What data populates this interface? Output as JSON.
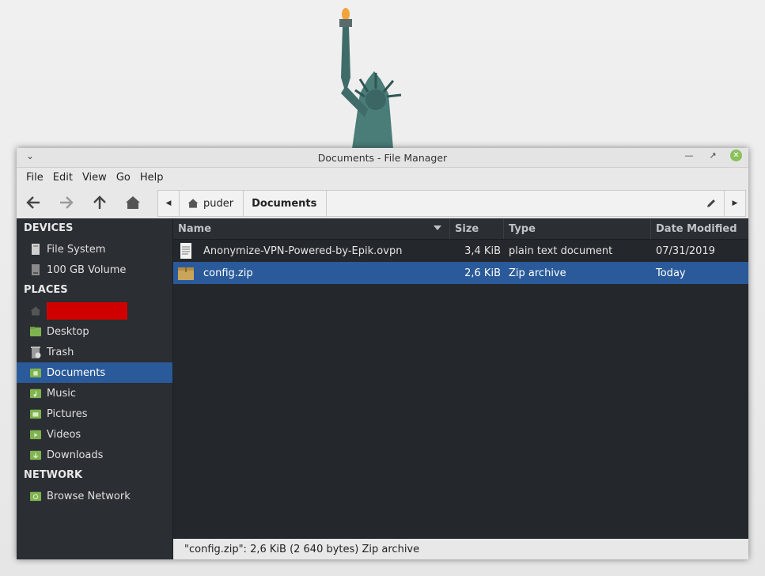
{
  "window": {
    "title": "Documents - File Manager"
  },
  "menu": [
    "File",
    "Edit",
    "View",
    "Go",
    "Help"
  ],
  "pathbar": {
    "crumbs": [
      "puder",
      "Documents"
    ]
  },
  "sidebar": {
    "devices_label": "DEVICES",
    "devices": [
      "File System",
      "100 GB Volume"
    ],
    "places_label": "PLACES",
    "places": [
      "Desktop",
      "Trash",
      "Documents",
      "Music",
      "Pictures",
      "Videos",
      "Downloads"
    ],
    "network_label": "NETWORK",
    "network": [
      "Browse Network"
    ]
  },
  "columns": {
    "name": "Name",
    "size": "Size",
    "type": "Type",
    "date": "Date Modified"
  },
  "files": [
    {
      "name": "Anonymize-VPN-Powered-by-Epik.ovpn",
      "size": "3,4 KiB",
      "type": "plain text document",
      "date": "07/31/2019"
    },
    {
      "name": "config.zip",
      "size": "2,6 KiB",
      "type": "Zip archive",
      "date": "Today"
    }
  ],
  "status": "\"config.zip\": 2,6 KiB (2 640 bytes) Zip archive",
  "colors": {
    "selection": "#2a5a99",
    "folder": "#7fb34f",
    "redaction": "#d10000"
  }
}
